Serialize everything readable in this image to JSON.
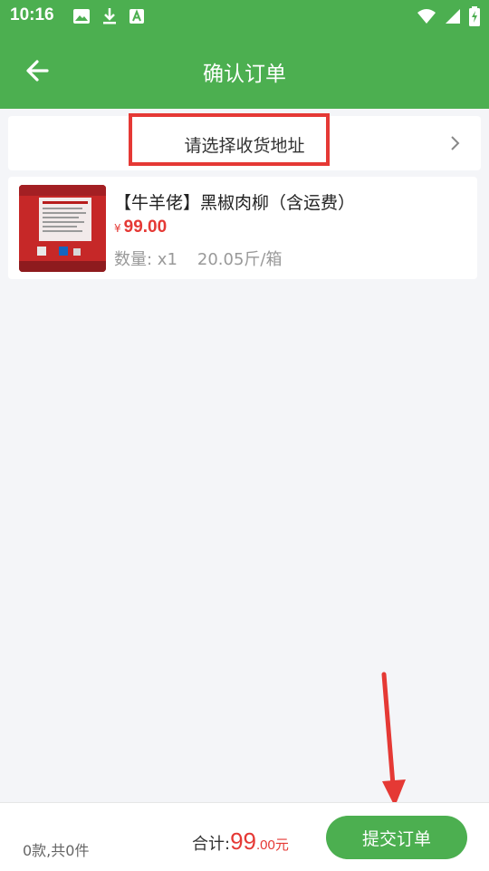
{
  "status_bar": {
    "time": "10:16",
    "left_icons": [
      "image-icon",
      "download-icon",
      "font-a-icon"
    ],
    "right_icons": [
      "wifi-icon",
      "signal-icon",
      "battery-charging-icon"
    ]
  },
  "header": {
    "title": "确认订单",
    "back_icon": "arrow-left-icon",
    "background_color": "#4caf50"
  },
  "address": {
    "placeholder": "请选择收货地址",
    "chevron_icon": "chevron-right-icon",
    "highlight_color": "#e53935"
  },
  "product": {
    "name": "【牛羊佬】黑椒肉柳（含运费）",
    "currency": "¥",
    "price": "99.00",
    "quantity": "数量: x1",
    "spec": "20.05斤/箱",
    "image_icon": "product-package-image"
  },
  "bottom_bar": {
    "count_text": "0款,共0件",
    "total_label": "合计:",
    "total_int": "99",
    "total_dec": ".00",
    "total_unit": "元",
    "submit_label": "提交订单",
    "price_color": "#e53935"
  }
}
